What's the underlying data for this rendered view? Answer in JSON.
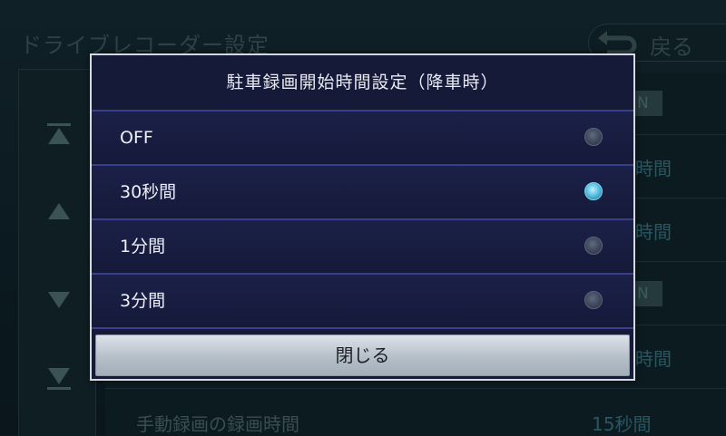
{
  "background": {
    "title": "ドライブレコーダー設定",
    "back_label": "戻る",
    "right_values": {
      "on_1": "N",
      "val_2": "時間",
      "val_3": "時間",
      "on_4": "N",
      "val_5": "時間"
    },
    "bottom_row": {
      "label": "手動録画の録画時間",
      "value": "15秒間"
    }
  },
  "dialog": {
    "title": "駐車録画開始時間設定（降車時）",
    "options": [
      {
        "label": "OFF",
        "selected": false
      },
      {
        "label": "30秒間",
        "selected": true
      },
      {
        "label": "1分間",
        "selected": false
      },
      {
        "label": "3分間",
        "selected": false
      }
    ],
    "close_label": "閉じる"
  },
  "colors": {
    "dialog_bg": "#151a39",
    "separator": "#3a3f8c",
    "radio_selected": "#49b6d8",
    "close_button": "#b5bfc8"
  }
}
